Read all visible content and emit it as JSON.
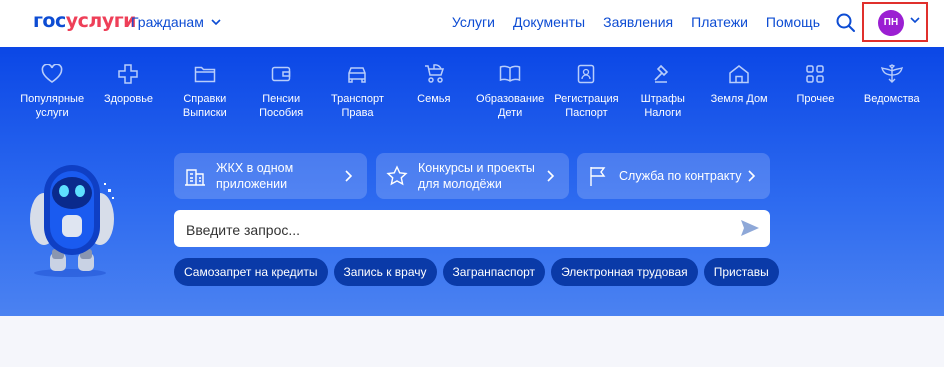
{
  "header": {
    "logo_part1": "гос",
    "logo_part2": "услуги",
    "audience": "Гражданам",
    "nav": [
      "Услуги",
      "Документы",
      "Заявления",
      "Платежи",
      "Помощь"
    ],
    "avatar_initials": "ПН"
  },
  "categories": [
    {
      "label": "Популярные услуги",
      "icon": "heart-icon"
    },
    {
      "label": "Здоровье",
      "icon": "health-cross-icon"
    },
    {
      "label": "Справки Выписки",
      "icon": "folder-icon"
    },
    {
      "label": "Пенсии Пособия",
      "icon": "wallet-icon"
    },
    {
      "label": "Транспорт Права",
      "icon": "car-icon"
    },
    {
      "label": "Семья",
      "icon": "stroller-icon"
    },
    {
      "label": "Образование Дети",
      "icon": "book-icon"
    },
    {
      "label": "Регистрация Паспорт",
      "icon": "passport-icon"
    },
    {
      "label": "Штрафы Налоги",
      "icon": "gavel-icon"
    },
    {
      "label": "Земля Дом",
      "icon": "house-icon"
    },
    {
      "label": "Прочее",
      "icon": "grid-icon"
    },
    {
      "label": "Ведомства",
      "icon": "eagle-icon"
    }
  ],
  "promos": [
    {
      "text": "ЖКХ в одном приложении",
      "icon": "building-icon"
    },
    {
      "text": "Конкурсы и проекты для молодёжи",
      "icon": "star-icon"
    },
    {
      "text": "Служба по контракту",
      "icon": "flag-icon"
    }
  ],
  "search": {
    "placeholder": "Введите запрос..."
  },
  "chips": [
    "Самозапрет на кредиты",
    "Запись к врачу",
    "Загранпаспорт",
    "Электронная трудовая",
    "Приставы"
  ],
  "colors": {
    "brand_blue": "#0d4cd3",
    "brand_red": "#ee3f58",
    "hero": "#0b47e6",
    "avatar": "#9b1fd2",
    "chip": "#0a3aa8"
  }
}
